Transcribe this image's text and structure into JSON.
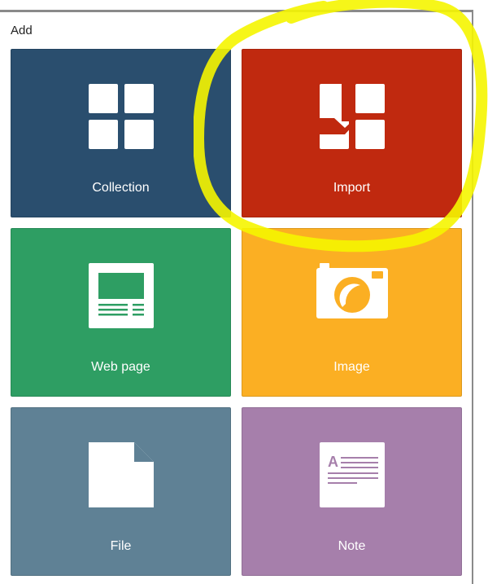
{
  "dialog": {
    "title": "Add"
  },
  "tiles": [
    {
      "label": "Collection",
      "icon": "collection-grid-icon",
      "color": "#2a4e6e"
    },
    {
      "label": "Import",
      "icon": "import-icon",
      "color": "#c0290f"
    },
    {
      "label": "Web page",
      "icon": "web-page-icon",
      "color": "#2e9e63"
    },
    {
      "label": "Image",
      "icon": "camera-icon",
      "color": "#fbaf23"
    },
    {
      "label": "File",
      "icon": "file-icon",
      "color": "#5f8195"
    },
    {
      "label": "Note",
      "icon": "note-icon",
      "color": "#a67fab"
    }
  ],
  "annotation": {
    "shape": "yellow-hand-drawn-circle",
    "color": "#f5f500",
    "target": "Import"
  }
}
